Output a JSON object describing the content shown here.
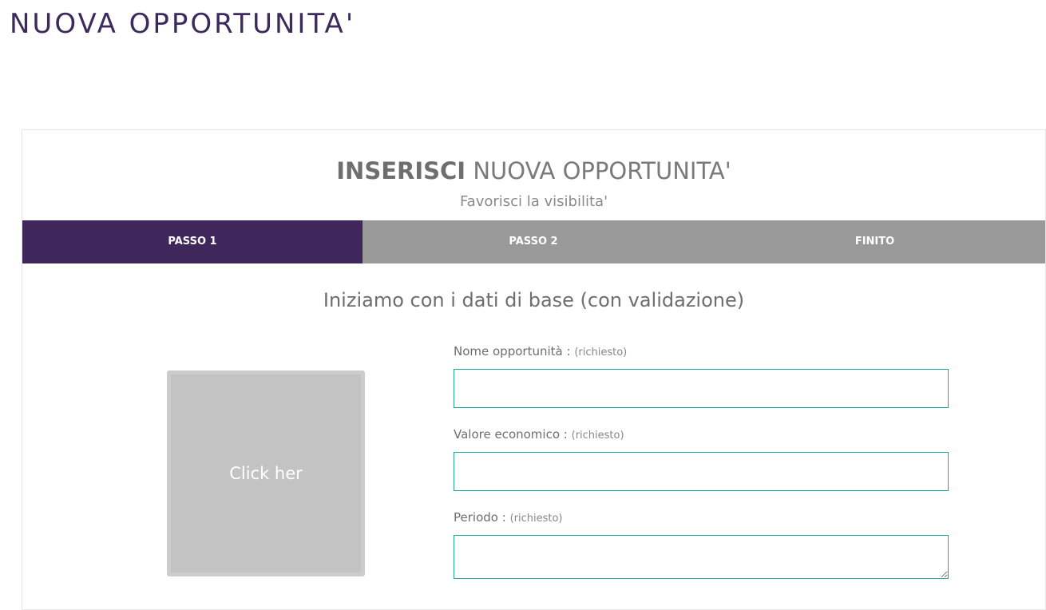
{
  "page": {
    "title": "NUOVA OPPORTUNITA'"
  },
  "card": {
    "heading_strong": "INSERISCI",
    "heading_rest": "NUOVA OPPORTUNITA'",
    "subheading": "Favorisci la visibilita'"
  },
  "steps": [
    {
      "label": "PASSO 1",
      "active": true
    },
    {
      "label": "PASSO 2",
      "active": false
    },
    {
      "label": "FINITO",
      "active": false
    }
  ],
  "form": {
    "section_title": "Iniziamo con i dati di base (con validazione)",
    "image_placeholder": "Click her",
    "fields": [
      {
        "label": "Nome opportunità :",
        "hint": "(richiesto)",
        "value": ""
      },
      {
        "label": "Valore economico :",
        "hint": "(richiesto)",
        "value": ""
      },
      {
        "label": "Periodo :",
        "hint": "(richiesto)",
        "value": ""
      }
    ]
  },
  "colors": {
    "accent": "#3f275c",
    "step_inactive": "#999999",
    "input_border": "#26a69a",
    "title": "#3d2a5c"
  }
}
